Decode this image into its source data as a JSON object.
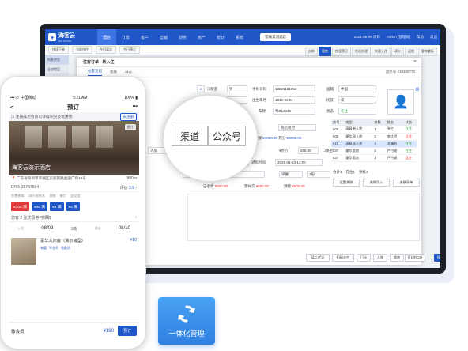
{
  "desktop": {
    "logo_text": "海客云",
    "logo_sub": "HAI CLOUD",
    "nav": [
      "酒店",
      "订单",
      "客户",
      "营销",
      "财务",
      "房产",
      "统计",
      "系统"
    ],
    "hotel_select": "客栈云测酒店",
    "date": "2021-05-06 周日",
    "user": "Admin [管理员]",
    "nav_right": [
      "帮助",
      "退出"
    ],
    "subbar": [
      "快速下单",
      "当前在住",
      "今日离店",
      "今日预订"
    ],
    "sidebar": [
      "所有房型",
      "全部楼层",
      "全部楼层"
    ],
    "right_buttons": [
      "自助",
      "客房",
      "快速预订",
      "快速办理",
      "快速入住",
      "读卡",
      "远程",
      "客房看板"
    ],
    "dialog": {
      "title": "住客订单 - 新入住",
      "close": "×",
      "tabs": [
        "住客登记",
        "客账",
        "日志"
      ],
      "order_no_label": "流水号",
      "order_no": "210405770",
      "rows": {
        "confidential": "保密",
        "gender": "男",
        "phone_label": "手机号码",
        "phone": "13821151251",
        "country_label": "国籍",
        "country": "中国",
        "id_label": "证件号码",
        "birth_label": "出生年月",
        "birth": "1819-02-01",
        "ethnic_label": "民族",
        "ethnic": "汉",
        "plate_label": "车牌",
        "plate": "粤B12345",
        "status_label": "状态",
        "status": "在住",
        "arrival": "到店现付",
        "balance_label": "余额",
        "balance": "¥3000.00",
        "points_label": "积分",
        "points": "¥3000.00",
        "room_type": "人房",
        "adjust": "原价",
        "price": "288.00",
        "confidential2": "保密",
        "days": "1",
        "days_unit": "晚",
        "depart_label": "退房时间",
        "depart": "2021-01-13 14:00",
        "promoter_label": "推广员",
        "promoter": "李峰",
        "meal": "早餐",
        "meal_count": "1份",
        "totals": [
          {
            "label": "已收款",
            "value": "¥500.00"
          },
          {
            "label": "需补交",
            "value": "¥500.00"
          },
          {
            "label": "预授",
            "value": "¥500.00"
          }
        ]
      },
      "rooms_table": {
        "headers": [
          "房号",
          "房型",
          "房数",
          "姓名",
          "状态"
        ],
        "rows": [
          [
            "508",
            "高级单人房",
            "1",
            "张三",
            "在住"
          ],
          [
            "506",
            "豪华双人房",
            "2",
            "李红玲",
            "远住"
          ],
          [
            "518",
            "高级双人房",
            "1",
            "武澜宏",
            "在住"
          ],
          [
            "537",
            "豪华套房",
            "2",
            "严丹妮",
            "在住"
          ],
          [
            "527",
            "豪华套房",
            "1",
            "严丹妮",
            "远住"
          ]
        ],
        "summary": [
          "合计4",
          "在住1",
          "预抵3"
        ]
      },
      "table_buttons": [
        "设置关联",
        "关联添入",
        "关联清单"
      ],
      "footer_buttons": [
        "读二代证",
        "扫码支付",
        "门卡",
        "入账",
        "换房",
        "打印RC单",
        "保存"
      ]
    },
    "magnifier": [
      "渠道",
      "公众号"
    ]
  },
  "phone": {
    "status_left": "中国移动",
    "time": "5:21 AM",
    "battery": "100%",
    "title": "预订",
    "back": "<",
    "more": "•••",
    "notice": "注册成为会员可获得积分及优惠券",
    "notice_btn": "去注册",
    "photo_tag": "图片",
    "hotel_name": "海客云演示酒店",
    "address": "广东省深圳市罗湖区贝丽南路金丽广场48号",
    "distance": "800m",
    "phone": "0755-25787564",
    "score_label": "评价",
    "score": "3.9",
    "tags": [
      "免费停车",
      "24小时热水",
      "宠物",
      "餐厅",
      "会议室"
    ],
    "coupons": [
      {
        "v": "¥100",
        "u": "满",
        "red": true
      },
      {
        "v": "¥86",
        "u": "满",
        "red": false
      },
      {
        "v": "¥8",
        "u": "满",
        "red": false
      },
      {
        "v": "¥5",
        "u": "满",
        "red": false
      }
    ],
    "coupon_note": "您有 2 张优惠券可领取",
    "checkin_label": "入住",
    "checkin": "08/09",
    "nights": "1晚",
    "checkout_label": "离店",
    "checkout": "08/10",
    "room_name": "豪华大床房（演示房型）",
    "room_price": "¥10",
    "room_tags": [
      "有窗",
      "不含早",
      "免取消"
    ],
    "member_label": "微会员",
    "total": "¥190",
    "book": "预订"
  },
  "badge": {
    "label": "一体化管理",
    "icon": "refresh-icon"
  }
}
